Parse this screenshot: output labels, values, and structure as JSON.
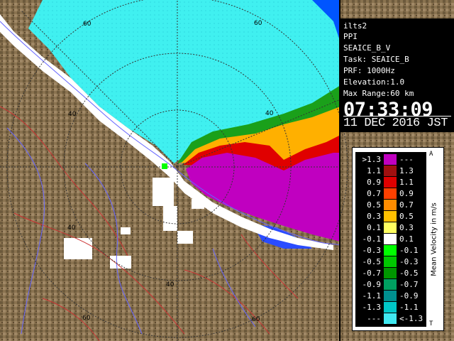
{
  "info_panel": {
    "station": "ilts2",
    "product": "PPI",
    "product_name": "SEAICE_B_V",
    "task": "Task: SEAICE_B",
    "prf": "PRF: 1000Hz",
    "elevation": "Elevation:1.0",
    "max_range": "Max Range:60 km",
    "time": "07:33:09",
    "date": "11 DEC 2016 JST"
  },
  "range_rings": {
    "labels": [
      "20",
      "40",
      "60",
      "40",
      "40",
      "60",
      "40",
      "40",
      "60",
      "60",
      "40"
    ]
  },
  "legend": {
    "title": "Mean Velocity in m/s",
    "top_mark": "A",
    "bottom_mark": "T",
    "rows": [
      {
        "lo": ">1.3",
        "hi": "---",
        "color": "#c000c0"
      },
      {
        "lo": "1.1",
        "hi": "1.3",
        "color": "#a01010"
      },
      {
        "lo": "0.9",
        "hi": "1.1",
        "color": "#e00000"
      },
      {
        "lo": "0.7",
        "hi": "0.9",
        "color": "#ff4000"
      },
      {
        "lo": "0.5",
        "hi": "0.7",
        "color": "#ff8c00"
      },
      {
        "lo": "0.3",
        "hi": "0.5",
        "color": "#ffc000"
      },
      {
        "lo": "0.1",
        "hi": "0.3",
        "color": "#ffff60"
      },
      {
        "lo": "-0.1",
        "hi": "0.1",
        "color": "#ffffff"
      },
      {
        "lo": "-0.3",
        "hi": "-0.1",
        "color": "#00ff00"
      },
      {
        "lo": "-0.5",
        "hi": "-0.3",
        "color": "#00c800"
      },
      {
        "lo": "-0.7",
        "hi": "-0.5",
        "color": "#009600"
      },
      {
        "lo": "-0.9",
        "hi": "-0.7",
        "color": "#00a060"
      },
      {
        "lo": "-1.1",
        "hi": "-0.9",
        "color": "#009090"
      },
      {
        "lo": "-1.3",
        "hi": "-1.1",
        "color": "#00c8c8"
      },
      {
        "lo": "---",
        "hi": "<-1.3",
        "color": "#40e8f0"
      }
    ]
  },
  "colors": {
    "land": "#8a7350",
    "land_dark": "#5e4a30",
    "sea_ice": "#40f0f0",
    "ocean_far": "#0055ff",
    "strong_positive": "#c000c0",
    "white_echo": "#ffffff",
    "ring_color": "#222222",
    "coast_color": "#6666ff",
    "river_color": "#cc3333"
  }
}
